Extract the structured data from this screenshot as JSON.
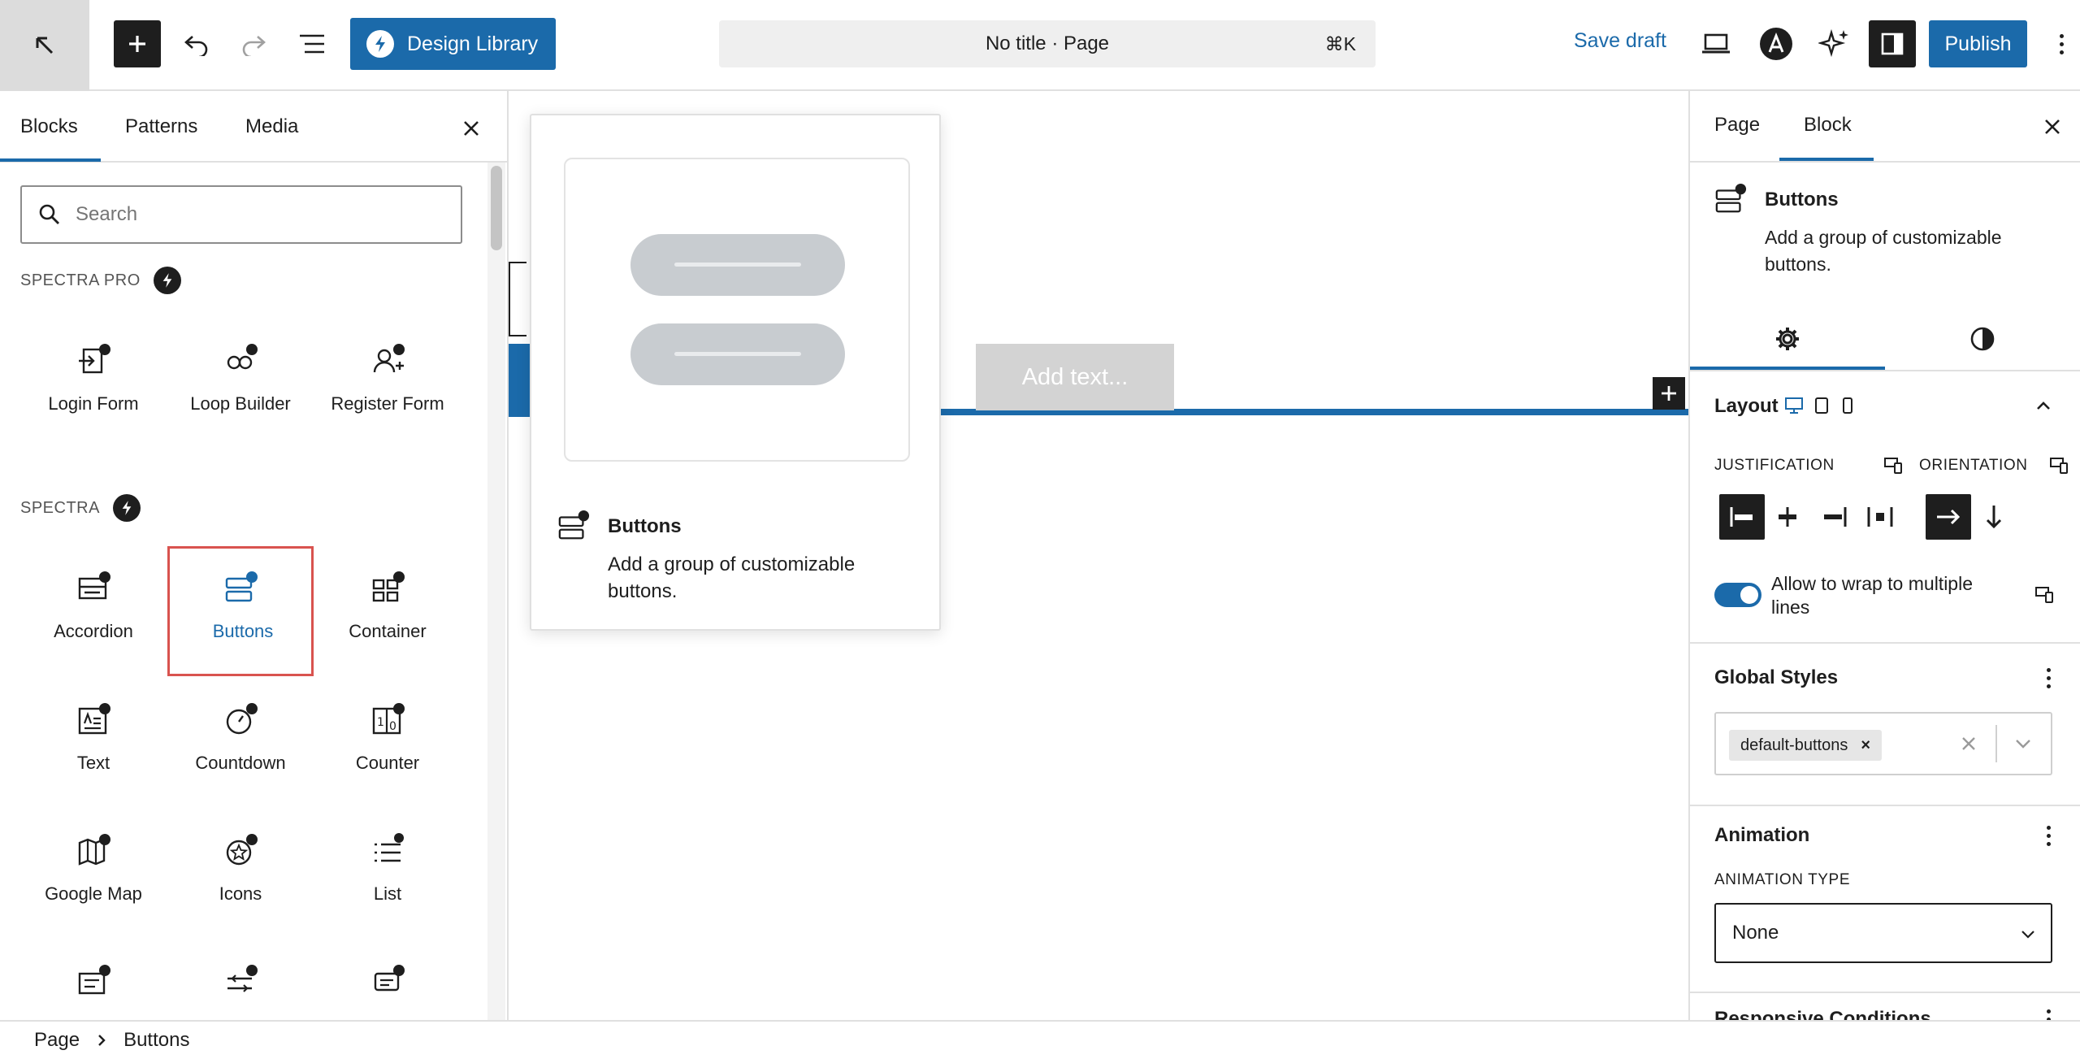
{
  "topbar": {
    "design_library_label": "Design Library",
    "document_title": "No title · Page",
    "shortcut": "⌘K",
    "save_draft_label": "Save draft",
    "publish_label": "Publish"
  },
  "inserter": {
    "tabs": [
      {
        "label": "Blocks",
        "active": true
      },
      {
        "label": "Patterns",
        "active": false
      },
      {
        "label": "Media",
        "active": false
      }
    ],
    "search_placeholder": "Search",
    "sections": [
      {
        "title": "SPECTRA PRO",
        "blocks": [
          "Login Form",
          "Loop Builder",
          "Register Form"
        ]
      },
      {
        "title": "SPECTRA",
        "blocks": [
          "Accordion",
          "Buttons",
          "Container",
          "Text",
          "Countdown",
          "Counter",
          "Google Map",
          "Icons",
          "List"
        ]
      }
    ],
    "selected_block": "Buttons"
  },
  "canvas": {
    "add_text_placeholder": "Add text..."
  },
  "preview": {
    "title": "Buttons",
    "description": "Add a group of customizable buttons."
  },
  "sidebar": {
    "tabs": [
      {
        "label": "Page",
        "active": false
      },
      {
        "label": "Block",
        "active": true
      }
    ],
    "block_title": "Buttons",
    "block_description": "Add a group of customizable buttons.",
    "layout": {
      "heading": "Layout",
      "justification_label": "JUSTIFICATION",
      "orientation_label": "ORIENTATION",
      "wrap_label": "Allow to wrap to multiple lines",
      "wrap_enabled": true
    },
    "global_styles": {
      "heading": "Global Styles",
      "selected": "default-buttons"
    },
    "animation": {
      "heading": "Animation",
      "type_label": "ANIMATION TYPE",
      "type_value": "None"
    },
    "next_section_heading": "Responsive Conditions"
  },
  "breadcrumb": [
    "Page",
    "Buttons"
  ],
  "colors": {
    "accent": "#1b6aaa",
    "dark": "#1e1e1e",
    "selection": "#d9534f"
  }
}
